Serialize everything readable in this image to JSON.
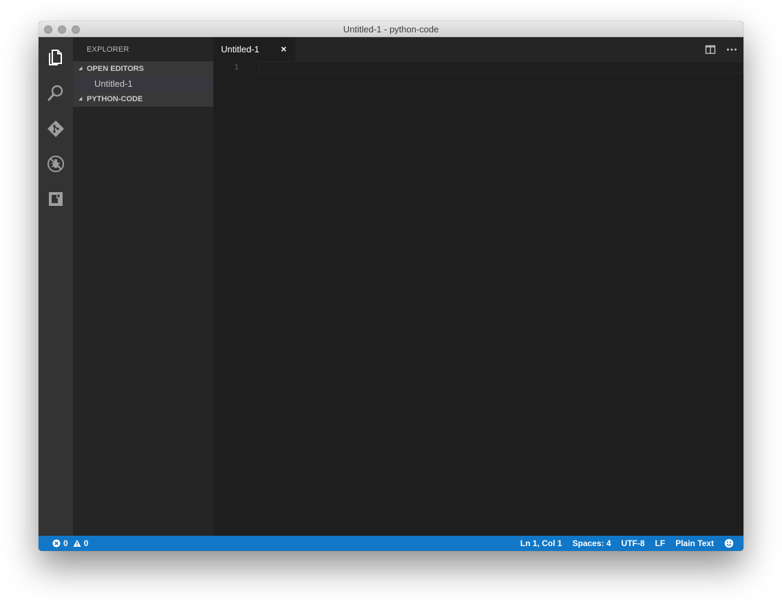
{
  "window": {
    "title": "Untitled-1 - python-code"
  },
  "activity_bar": {
    "items": [
      {
        "icon": "files-icon"
      },
      {
        "icon": "search-icon"
      },
      {
        "icon": "source-control-icon"
      },
      {
        "icon": "debug-icon"
      },
      {
        "icon": "extensions-icon"
      }
    ]
  },
  "sidebar": {
    "title": "EXPLORER",
    "sections": [
      {
        "label": "OPEN EDITORS",
        "items": [
          "Untitled-1"
        ]
      },
      {
        "label": "PYTHON-CODE",
        "items": []
      }
    ]
  },
  "editor": {
    "tabs": [
      {
        "label": "Untitled-1",
        "close": "×"
      }
    ],
    "actions": [
      "split-editor-icon",
      "more-actions-icon"
    ],
    "line_numbers": [
      "1"
    ]
  },
  "status_bar": {
    "errors": "0",
    "warnings": "0",
    "position": "Ln 1, Col 1",
    "spaces": "Spaces: 4",
    "encoding": "UTF-8",
    "eol": "LF",
    "language": "Plain Text",
    "feedback_icon": "smiley-icon"
  },
  "colors": {
    "status_bar": "#1177c6",
    "activity_bar": "#333333",
    "sidebar": "#252526",
    "editor": "#1e1e1e"
  }
}
